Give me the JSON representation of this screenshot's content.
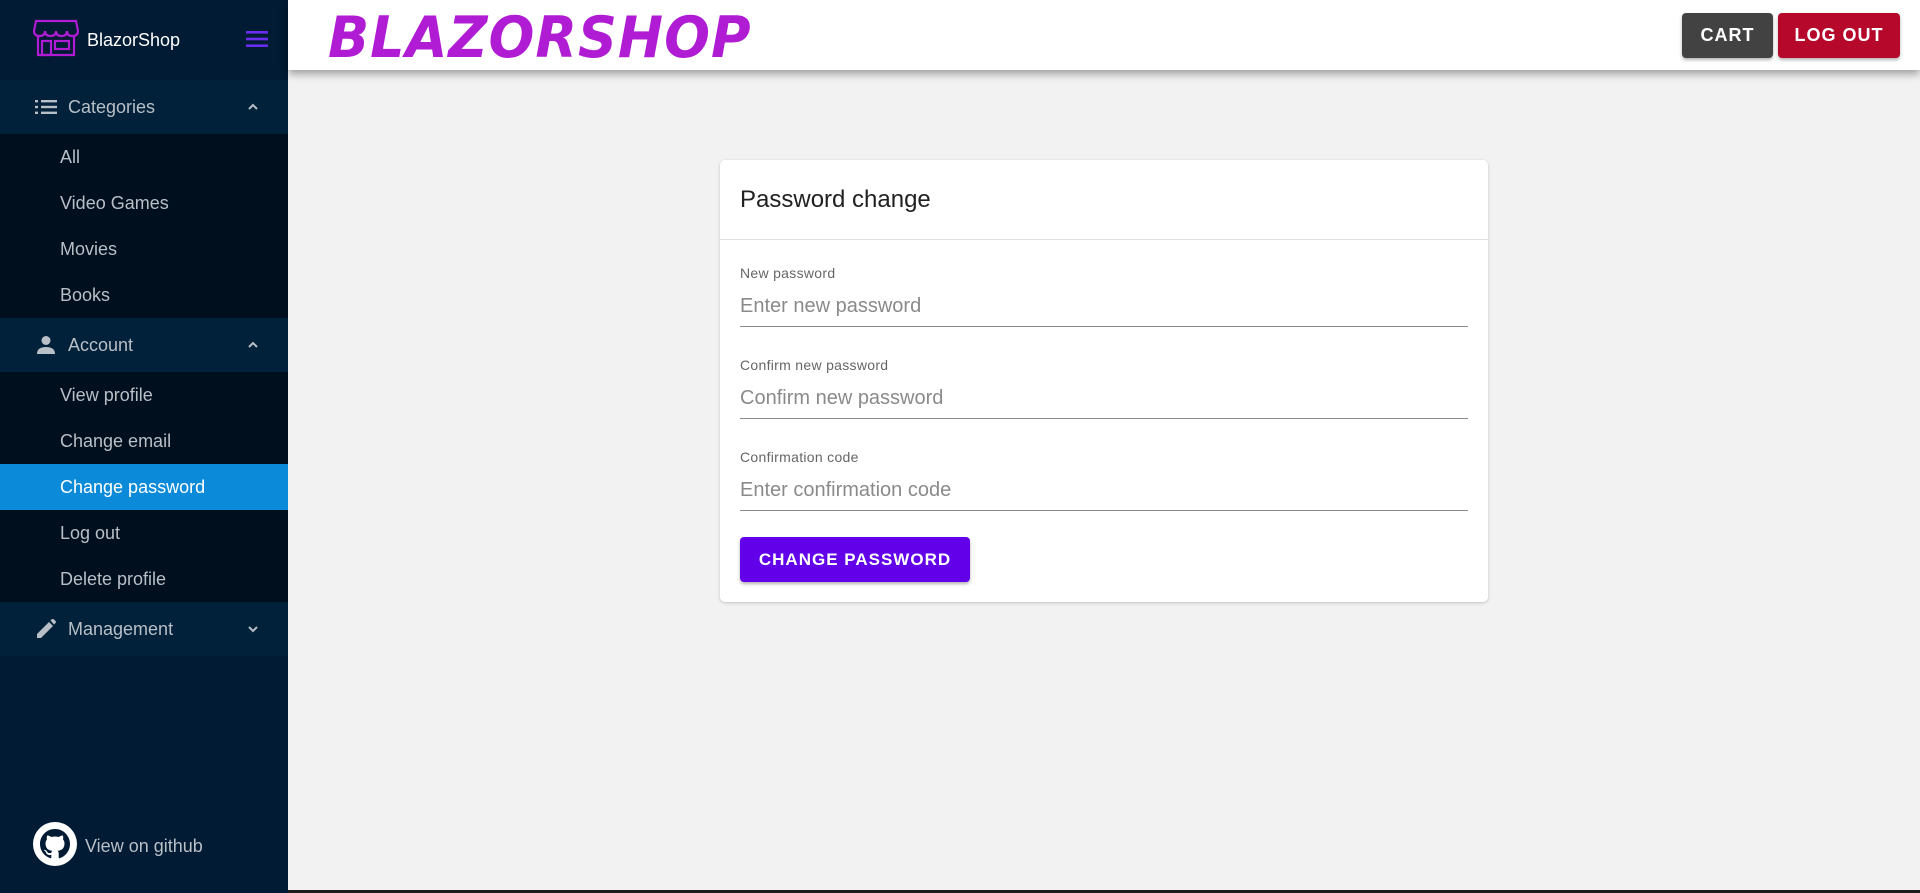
{
  "app": {
    "brand": "BlazorShop",
    "logo_text": "BLAZORSHOP"
  },
  "colors": {
    "sidebar": "#001b33",
    "active": "#0a8ad8",
    "primary": "#6200ea",
    "logout": "#b5082b",
    "logo": "#b01bd4"
  },
  "sidebar": {
    "categories": {
      "label": "Categories",
      "icon": "list-icon",
      "items": [
        "All",
        "Video Games",
        "Movies",
        "Books"
      ]
    },
    "account": {
      "label": "Account",
      "icon": "person-icon",
      "items": [
        "View profile",
        "Change email",
        "Change password",
        "Log out",
        "Delete profile"
      ],
      "active": "Change password"
    },
    "management": {
      "label": "Management",
      "icon": "pencil-icon"
    },
    "footer": {
      "label": "View on github",
      "icon": "github-icon"
    }
  },
  "topbar": {
    "cart_label": "CART",
    "logout_label": "LOG OUT"
  },
  "form": {
    "title": "Password change",
    "new_password": {
      "label": "New password",
      "placeholder": "Enter new password"
    },
    "confirm_password": {
      "label": "Confirm new password",
      "placeholder": "Confirm new password"
    },
    "confirmation_code": {
      "label": "Confirmation code",
      "placeholder": "Enter confirmation code"
    },
    "submit_label": "CHANGE PASSWORD"
  }
}
